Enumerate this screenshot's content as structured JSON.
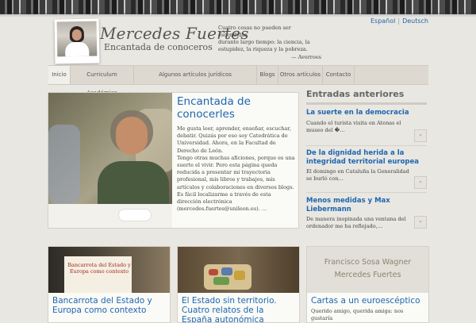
{
  "lang": {
    "es": "Español",
    "sep": "|",
    "de": "Deutsch"
  },
  "header": {
    "title": "Mercedes Fuertes",
    "subtitle": "Encantada de conoceros",
    "quote_lines": [
      "Cuatro cosas no pueden ser escondidas",
      "durante largo tiempo: la ciencia, la",
      "estupidez, la riqueza y la pobreza."
    ],
    "quote_author": "— Averroes"
  },
  "nav": {
    "items": [
      "Inicio",
      "Curriculum Académico",
      "Algunos artículos jurídicos",
      "Blogs",
      "Otros artículos",
      "Contacto"
    ]
  },
  "feature": {
    "title": "Encantada de conocerles",
    "body": "Me gusta leer, aprender, enseñar, escuchar, debatir. Quizás por eso soy Catedrática de Universidad. Ahora, en la Facultad de Derecho de León.",
    "body2": "Tengo otras muchas aficiones, porque es una suerte el vivir. Pero esta página queda reducida a presentar mi trayectoria profesional, mis libros y trabajos, mis artículos y colaboraciones en diversos blogs.",
    "body3": "Es fácil localizarme a través de esta dirección electrónica (mercedes.fuertes@unileon.es). …"
  },
  "sidebar": {
    "heading": "Entradas anteriores",
    "entries": [
      {
        "title": "La suerte en la democracia",
        "excerpt": "Cuando el turista visita en Atenas el museo del �…",
        "more": "»"
      },
      {
        "title": "De la dignidad herida a la integridad territorial europea",
        "excerpt": "El domingo en Cataluña la Generalidad se burló con…",
        "more": "»"
      },
      {
        "title": "Menos medidas y Max Liebermann",
        "excerpt": "De manera inopinada una ventana del ordenador me ha reflejado,…",
        "more": "»"
      }
    ]
  },
  "cards": [
    {
      "title": "Bancarrota del Estado y Europa como contexto",
      "text": "",
      "book_title": "Bancarrota del Estado y Europa como contexto"
    },
    {
      "title": "El Estado sin territorio. Cuatro relatos de la España autonómica",
      "text": ""
    },
    {
      "title": "Cartas a un euroescéptico",
      "text": "Querido amigo, querida amiga: nos gustaría",
      "cover_line1": "Francisco Sosa Wagner",
      "cover_line2": "Mercedes Fuertes"
    }
  ],
  "colors": {
    "link": "#1e67b0",
    "background": "#e9e7e1"
  }
}
